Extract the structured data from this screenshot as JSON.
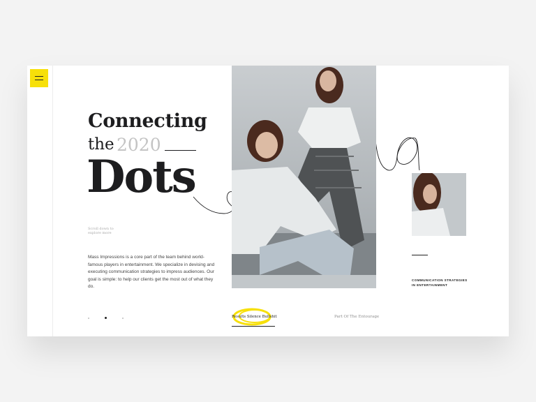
{
  "menu": {
    "icon": "hamburger-icon",
    "accent_color": "#f7e00a"
  },
  "hero": {
    "line1": "Connecting",
    "line2_word": "the",
    "line2_year": "2020",
    "line3": "Dots"
  },
  "scroll_hint": "Scroll down to explore more",
  "body_text": "Mass Impressions is a core part of the team behind world-famous players in entertainment. We specialize in devising and executing communication strategies to impress audiences. Our goal is simple: to help our clients get the most out of what they do.",
  "pagination": {
    "total": 3,
    "active_index": 1
  },
  "cta": {
    "label": "Results Silence Bullshit"
  },
  "secondary_link": "Part Of The Entourage",
  "side_caption": "COMMUNICATION STRATEGIES IN ENTERTAINMENT",
  "colors": {
    "accent": "#f7e00a",
    "text": "#1d1d1f",
    "muted": "#c4c4c4"
  }
}
